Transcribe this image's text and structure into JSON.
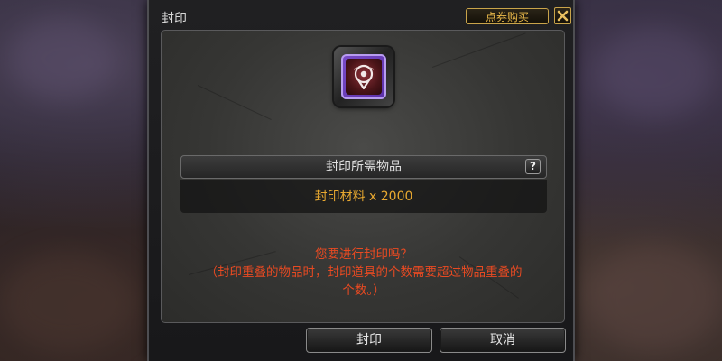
{
  "window": {
    "title": "封印",
    "shop_label": "点券购买"
  },
  "requirement": {
    "header": "封印所需物品",
    "help_label": "?",
    "item": "封印材料 x 2000"
  },
  "message": {
    "line1": "您要进行封印吗？",
    "line2": "（封印重叠的物品时，封印道具的个数需要超过物品重叠的",
    "line3": "个数。）"
  },
  "buttons": {
    "confirm": "封印",
    "cancel": "取消"
  },
  "colors": {
    "gold_accent": "#e8a830",
    "warning_text": "#e84a22",
    "icon_purple": "#7a4cc8"
  },
  "icons": {
    "seal_item": "seal-stamp-icon",
    "close": "close-icon"
  }
}
